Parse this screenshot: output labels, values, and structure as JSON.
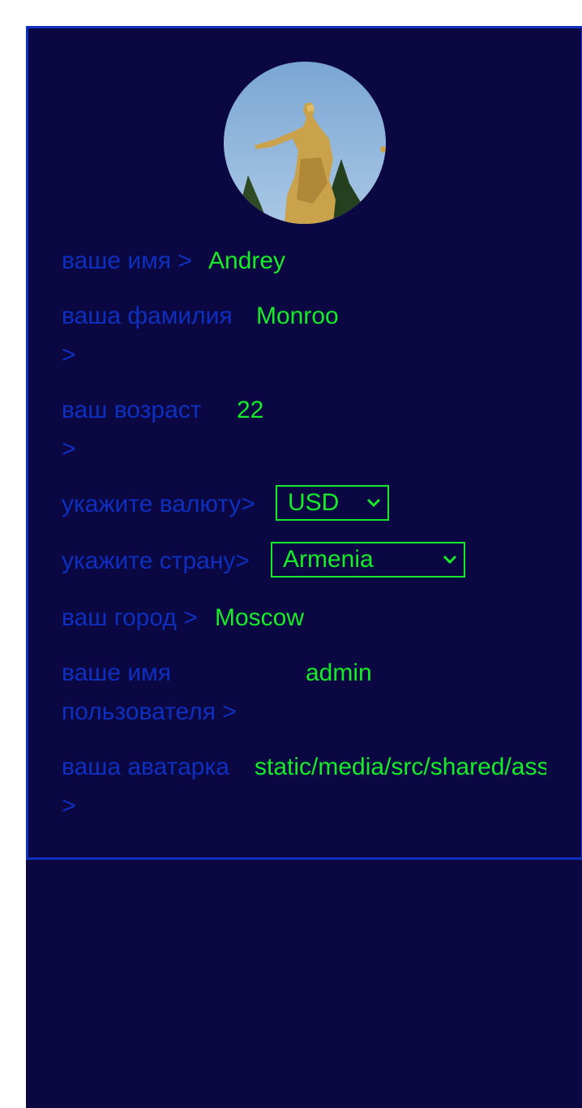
{
  "profile": {
    "first_name": {
      "label": "ваше имя >",
      "value": "Andrey"
    },
    "last_name": {
      "label_line1": "ваша фамилия",
      "label_line2": ">",
      "value": "Monroo"
    },
    "age": {
      "label_line1": "ваш возраст",
      "label_line2": ">",
      "value": "22"
    },
    "currency": {
      "label": "укажите валюту>",
      "selected": "USD"
    },
    "country": {
      "label": "укажите страну>",
      "selected": "Armenia"
    },
    "city": {
      "label": "ваш город >",
      "value": "Moscow"
    },
    "username": {
      "label_line1": "ваше имя",
      "label_line2": "пользователя >",
      "value": "admin"
    },
    "avatar_path": {
      "label_line1": "ваша аватарка",
      "label_line2": ">",
      "value": "static/media/src/shared/assets"
    }
  },
  "icons": {
    "avatar": "statue-photo-avatar",
    "dropdown": "chevron-down-icon"
  },
  "colors": {
    "background": "#0a0742",
    "label": "#0f2fbf",
    "value": "#16ec2a",
    "border": "#0f2fbf"
  }
}
